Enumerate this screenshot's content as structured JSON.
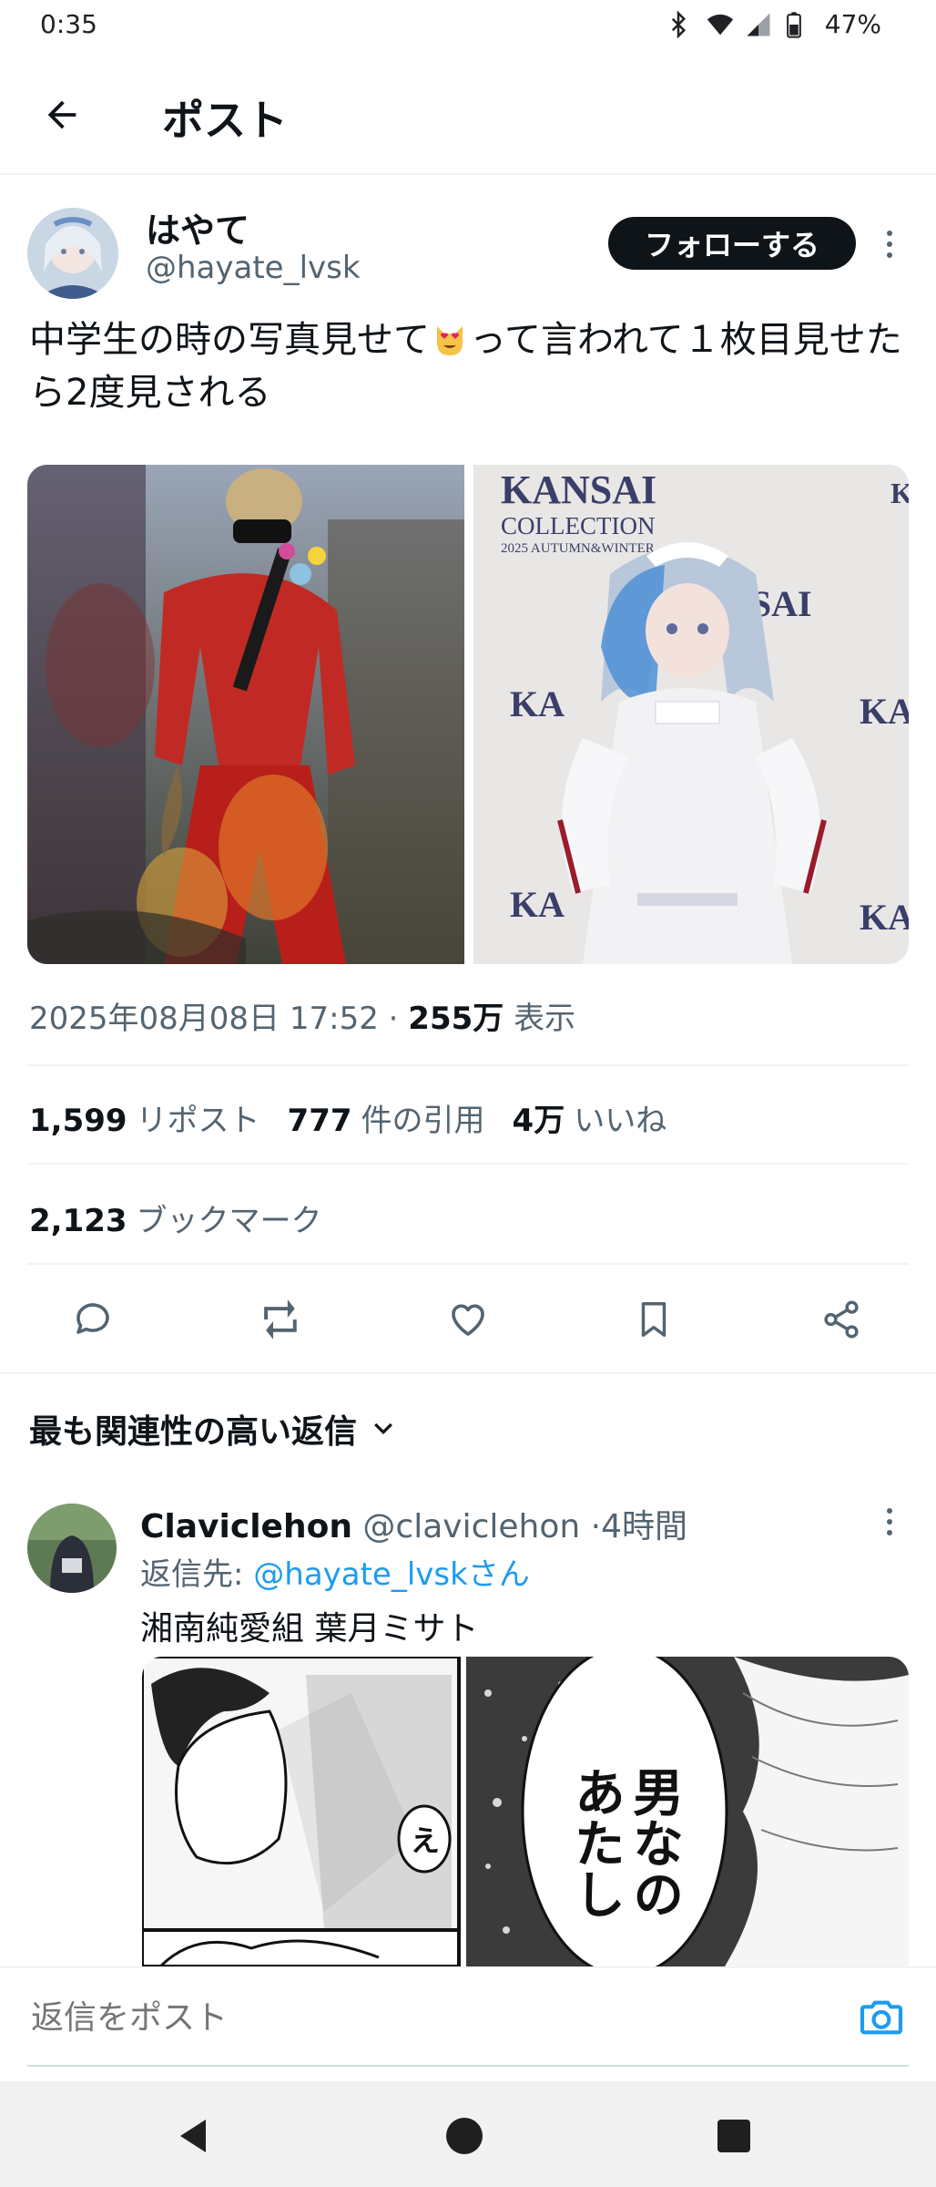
{
  "status_bar": {
    "time": "0:35",
    "battery": "47%"
  },
  "header": {
    "title": "ポスト",
    "back_icon": "arrow-left-icon"
  },
  "post": {
    "author_name": "はやて",
    "author_handle": "@hayate_lvsk",
    "follow_label": "フォローする",
    "text_part1": "中学生の時の写真見せて",
    "emoji": "heart-eyes-cat-emoji",
    "text_part2": "って言われて１枚目見せたら2度見される",
    "timestamp": "2025年08月08日 17:52",
    "separator": "·",
    "views_count": "255万",
    "views_label": "表示",
    "reposts_count": "1,599",
    "reposts_label": "リポスト",
    "quotes_count": "777",
    "quotes_label": "件の引用",
    "likes_count": "4万",
    "likes_label": "いいね",
    "bookmarks_count": "2,123",
    "bookmarks_label": "ブックマーク",
    "media": {
      "right_image_text": [
        "KANSAI",
        "COLLECTION",
        "2025 AUTUMN&WINTER"
      ]
    }
  },
  "replies": {
    "sort_label": "最も関連性の高い返信",
    "items": [
      {
        "name": "Claviclehon",
        "handle": "@claviclehon",
        "separator": "·",
        "time": "4時間",
        "reply_to_prefix": "返信先: ",
        "reply_to_handle": "@hayate_lvskさん",
        "text": "湘南純愛組 葉月ミサト",
        "manga_bubble_small": "え",
        "manga_bubble_line1": "男なの",
        "manga_bubble_line2": "あたし"
      }
    ]
  },
  "compose": {
    "placeholder": "返信をポスト"
  },
  "colors": {
    "accent": "#1d9bf0",
    "text": "#0f1419",
    "muted": "#536471"
  }
}
